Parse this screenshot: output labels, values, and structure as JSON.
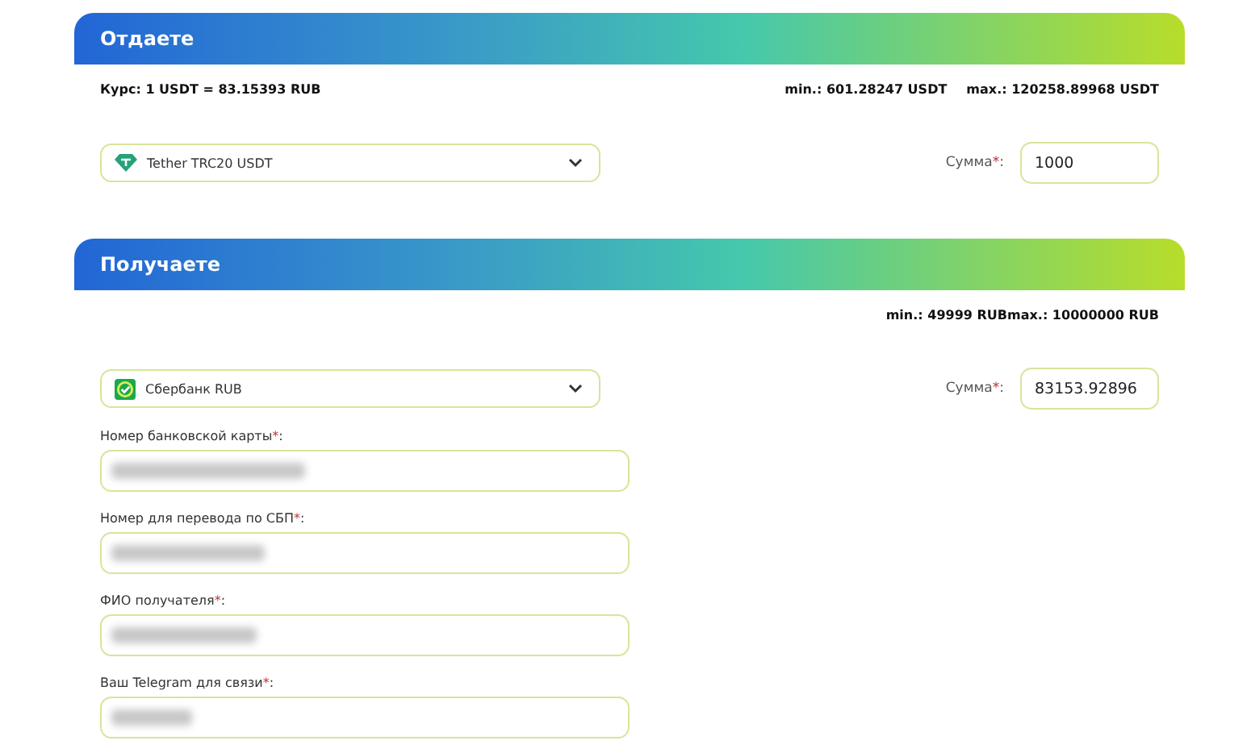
{
  "sections": [
    {
      "title": "Отдаете",
      "rate": "Курс: 1 USDT = 83.15393 RUB",
      "limits": [
        "min.: 601.28247 USDT",
        "max.: 120258.89968 USDT"
      ],
      "select": {
        "value": "Tether TRC20 USDT"
      },
      "amount": {
        "label": "Сумма",
        "asterisk": "*",
        "tail": ":",
        "value": "1000"
      }
    },
    {
      "title": "Получаете",
      "limits": [
        "min.: 49999 RUBmax.: 10000000 RUB"
      ],
      "select": {
        "value": "Сбербанк RUB"
      },
      "amount": {
        "label": "Сумма",
        "asterisk": "*",
        "tail": ":",
        "value": "83153.92896"
      },
      "fields": [
        {
          "label": "Номер банковской карты",
          "asterisk": "*",
          "tail": ":",
          "blurred": true
        },
        {
          "label": "Номер для перевода по СБП",
          "asterisk": "*",
          "tail": ":",
          "blurred": true
        },
        {
          "label": "ФИО получателя",
          "asterisk": "*",
          "tail": ":",
          "blurred": true
        },
        {
          "label": "Ваш Telegram для связи",
          "asterisk": "*",
          "tail": ":",
          "blurred": true
        }
      ]
    }
  ]
}
